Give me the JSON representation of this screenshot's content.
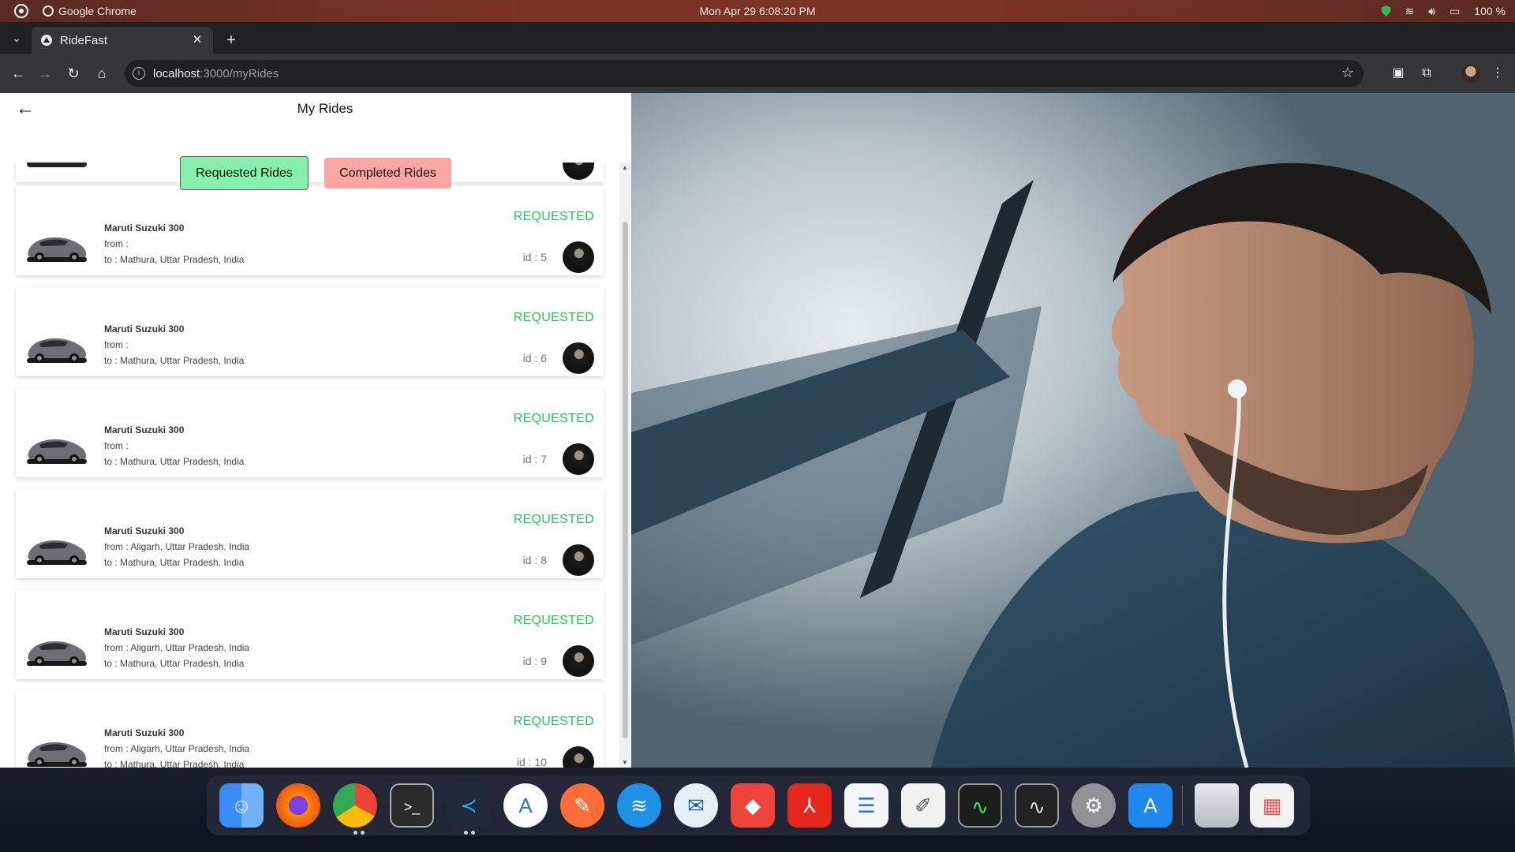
{
  "system_bar": {
    "app_name": "Google Chrome",
    "datetime": "Mon Apr 29   6:08:20 PM",
    "battery": "100 %"
  },
  "browser": {
    "tab_title": "RideFast",
    "url_host": "localhost",
    "url_path": ":3000/myRides"
  },
  "page": {
    "title": "My Rides",
    "requested_label": "Requested Rides",
    "completed_label": "Completed Rides"
  },
  "rides": [
    {
      "car": "Maruti Suzuki 300",
      "from": "from :",
      "to": "to : Mathura, Uttar Pradesh, India",
      "status": "REQUESTED",
      "id": "id : 5"
    },
    {
      "car": "Maruti Suzuki 300",
      "from": "from :",
      "to": "to : Mathura, Uttar Pradesh, India",
      "status": "REQUESTED",
      "id": "id : 6"
    },
    {
      "car": "Maruti Suzuki 300",
      "from": "from :",
      "to": "to : Mathura, Uttar Pradesh, India",
      "status": "REQUESTED",
      "id": "id : 7"
    },
    {
      "car": "Maruti Suzuki 300",
      "from": "from : Aligarh, Uttar Pradesh, India",
      "to": "to : Mathura, Uttar Pradesh, India",
      "status": "REQUESTED",
      "id": "id : 8"
    },
    {
      "car": "Maruti Suzuki 300",
      "from": "from : Aligarh, Uttar Pradesh, India",
      "to": "to : Mathura, Uttar Pradesh, India",
      "status": "REQUESTED",
      "id": "id : 9"
    },
    {
      "car": "Maruti Suzuki 300",
      "from": "from : Aligarh, Uttar Pradesh, India",
      "to": "to : Mathura, Uttar Pradesh, India",
      "status": "REQUESTED",
      "id": "id : 10"
    }
  ],
  "colors": {
    "requested_button": "#86efac",
    "completed_button": "#fca5a5",
    "status_green": "#22c55e"
  },
  "dock": {
    "icons": [
      "finder-icon",
      "firefox-icon",
      "chrome-icon",
      "terminal-icon",
      "vscode-icon",
      "app-icon",
      "postman-icon",
      "docker-icon",
      "thunderbird-icon",
      "anydesk-icon",
      "acrobat-icon",
      "text-editor-icon",
      "notes-icon",
      "activity-monitor-icon",
      "system-monitor-icon",
      "settings-icon",
      "software-updater-icon",
      "trash-icon",
      "app-grid-icon"
    ]
  }
}
